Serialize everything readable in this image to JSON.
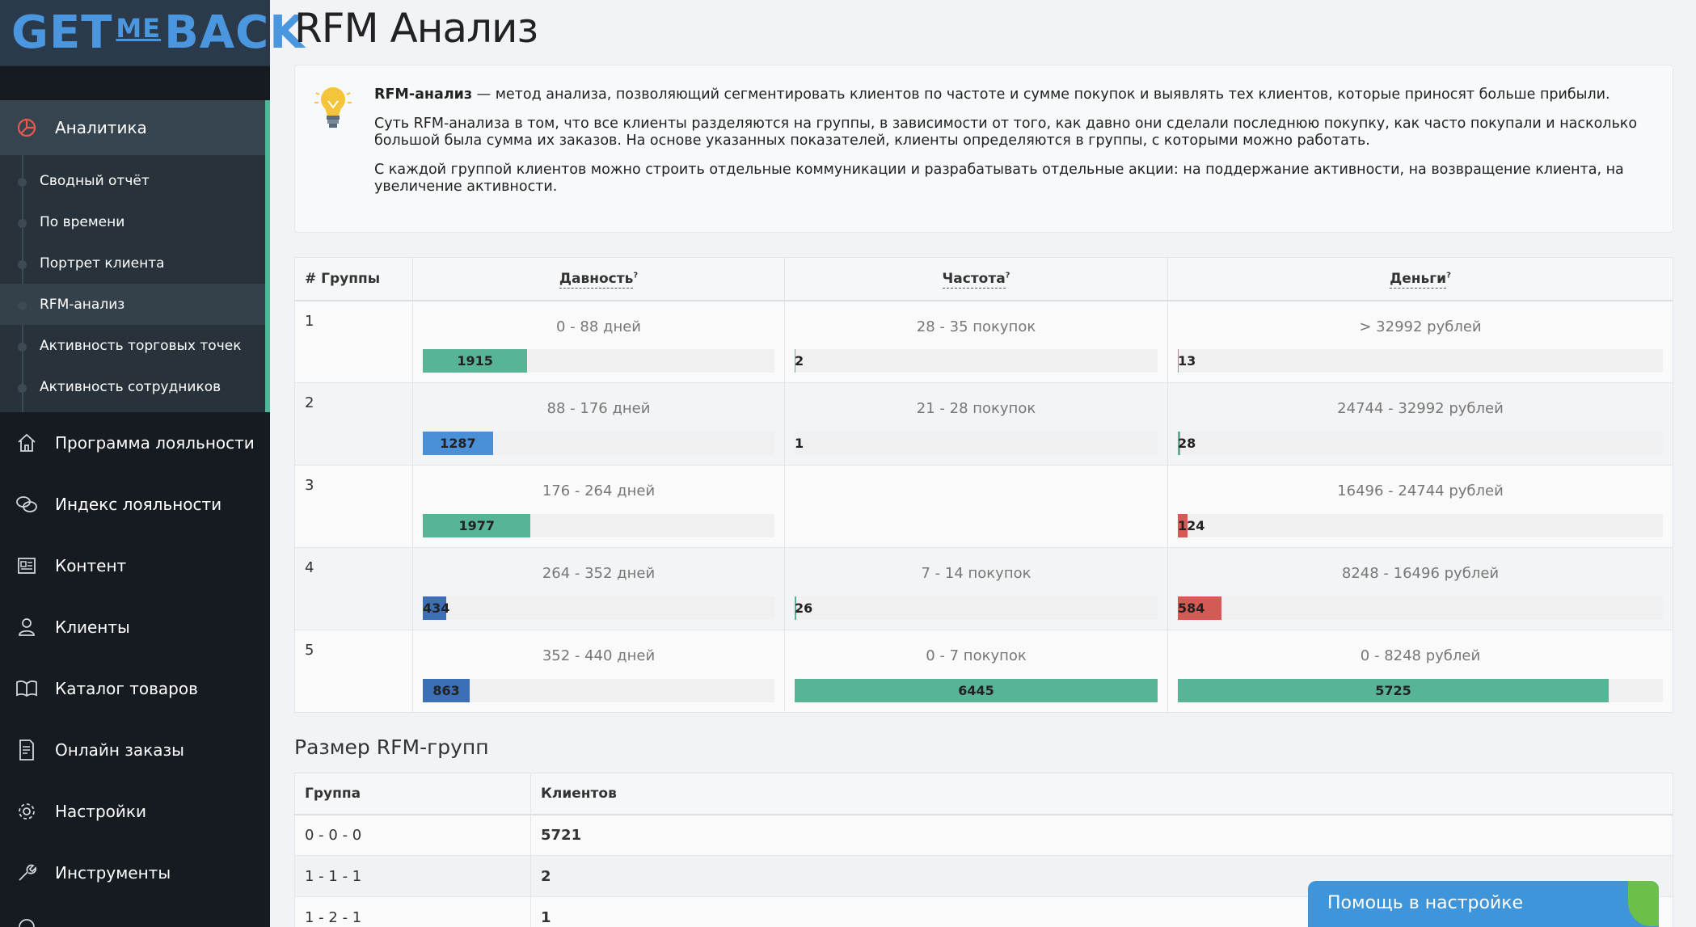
{
  "brand": {
    "logo_left": "GET",
    "logo_mid": "ME",
    "logo_right": "BACK"
  },
  "colors": {
    "green": "#58b497",
    "blue": "#4a90d9",
    "dark_blue": "#3c6fb5",
    "red": "#d35a55",
    "sidebar_bg": "#151b20",
    "accent_bar": "#53b597"
  },
  "sidebar": {
    "active": {
      "label": "Аналитика",
      "icon": "chart-pie-icon"
    },
    "sub_items": [
      {
        "label": "Сводный отчёт"
      },
      {
        "label": "По времени"
      },
      {
        "label": "Портрет клиента"
      },
      {
        "label": "RFM-анализ"
      },
      {
        "label": "Активность торговых точек"
      },
      {
        "label": "Активность сотрудников"
      }
    ],
    "items": [
      {
        "label": "Программа лояльности",
        "icon": "home-icon"
      },
      {
        "label": "Индекс лояльности",
        "icon": "chat-bubbles-icon"
      },
      {
        "label": "Контент",
        "icon": "newspaper-icon"
      },
      {
        "label": "Клиенты",
        "icon": "user-icon"
      },
      {
        "label": "Каталог товаров",
        "icon": "book-icon"
      },
      {
        "label": "Онлайн заказы",
        "icon": "receipt-icon"
      },
      {
        "label": "Настройки",
        "icon": "gear-icon"
      },
      {
        "label": "Инструменты",
        "icon": "wrench-icon"
      }
    ]
  },
  "page": {
    "title": "RFM Анализ"
  },
  "info": {
    "p1_bold": "RFM-анализ",
    "p1_rest": " — метод анализа, позволяющий сегментировать клиентов по частоте и сумме покупок и выявлять тех клиентов, которые приносят больше прибыли.",
    "p2": "Суть RFM-анализа в том, что все клиенты разделяются на группы, в зависимости от того, как давно они сделали последнюю покупку, как часто покупали и насколько большой была сумма их заказов. На основе указанных показателей, клиенты определяются в группы, с которыми можно работать.",
    "p3": "С каждой группой клиентов можно строить отдельные коммуникации и разрабатывать отдельные акции: на поддержание активности, на возвращение клиента, на увеличение активности."
  },
  "rfm": {
    "headers": {
      "group": "# Группы",
      "recency": "Давность",
      "frequency": "Частота",
      "monetary": "Деньги",
      "hint": "?"
    },
    "max": 6445,
    "rows": [
      {
        "group": "1",
        "r": {
          "range": "0 - 88 дней",
          "count": "1915",
          "value": 1915,
          "color": "#58b497"
        },
        "f": {
          "range": "28 - 35 покупок",
          "count": "2",
          "value": 2,
          "color": "#58b497"
        },
        "m": {
          "range": "> 32992 рублей",
          "count": "13",
          "value": 13,
          "color": "#58b497"
        }
      },
      {
        "group": "2",
        "r": {
          "range": "88 - 176 дней",
          "count": "1287",
          "value": 1287,
          "color": "#4a90d9"
        },
        "f": {
          "range": "21 - 28 покупок",
          "count": "1",
          "value": 1,
          "color": "#58b497"
        },
        "m": {
          "range": "24744 - 32992 рублей",
          "count": "28",
          "value": 28,
          "color": "#58b497"
        }
      },
      {
        "group": "3",
        "r": {
          "range": "176 - 264 дней",
          "count": "1977",
          "value": 1977,
          "color": "#58b497"
        },
        "f": null,
        "m": {
          "range": "16496 - 24744 рублей",
          "count": "124",
          "value": 124,
          "color": "#d35a55"
        }
      },
      {
        "group": "4",
        "r": {
          "range": "264 - 352 дней",
          "count": "434",
          "value": 434,
          "color": "#3c6fb5"
        },
        "f": {
          "range": "7 - 14 покупок",
          "count": "26",
          "value": 26,
          "color": "#58b497"
        },
        "m": {
          "range": "8248 - 16496 рублей",
          "count": "584",
          "value": 584,
          "color": "#d35a55"
        }
      },
      {
        "group": "5",
        "r": {
          "range": "352 - 440 дней",
          "count": "863",
          "value": 863,
          "color": "#3c6fb5"
        },
        "f": {
          "range": "0 - 7 покупок",
          "count": "6445",
          "value": 6445,
          "color": "#58b497"
        },
        "m": {
          "range": "0 - 8248 рублей",
          "count": "5725",
          "value": 5725,
          "color": "#58b497"
        }
      }
    ]
  },
  "sizes": {
    "title": "Размер RFM-групп",
    "headers": {
      "group": "Группа",
      "clients": "Клиентов"
    },
    "rows": [
      {
        "group": "0 - 0 - 0",
        "clients": "5721"
      },
      {
        "group": "1 - 1 - 1",
        "clients": "2"
      },
      {
        "group": "1 - 2 - 1",
        "clients": "1"
      }
    ]
  },
  "help": {
    "label": "Помощь в настройке"
  }
}
